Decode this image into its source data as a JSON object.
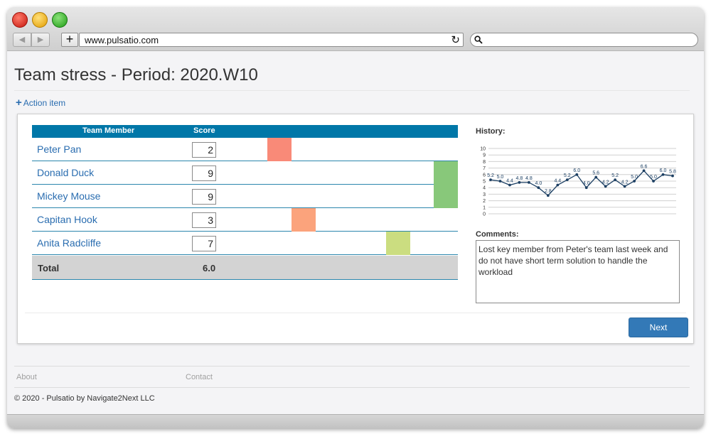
{
  "browser": {
    "url": "www.pulsatio.com",
    "icons": {
      "back": "back-arrow-icon",
      "forward": "forward-arrow-icon",
      "new_tab": "plus-icon",
      "reload": "reload-icon",
      "search": "search-icon"
    }
  },
  "page": {
    "title": "Team stress - Period: 2020.W10",
    "action_item_label": "Action item"
  },
  "table": {
    "headers": {
      "member": "Team Member",
      "score": "Score"
    },
    "rows": [
      {
        "name": "Peter Pan",
        "score": "2",
        "bar_color": "#f98a78"
      },
      {
        "name": "Donald Duck",
        "score": "9",
        "bar_color": "#88c87a"
      },
      {
        "name": "Mickey Mouse",
        "score": "9",
        "bar_color": "#88c87a"
      },
      {
        "name": "Capitan Hook",
        "score": "3",
        "bar_color": "#fba37c"
      },
      {
        "name": "Anita Radcliffe",
        "score": "7",
        "bar_color": "#cbdd80"
      }
    ],
    "score_scale": [
      1,
      10
    ],
    "total_label": "Total",
    "total_value": "6.0"
  },
  "history": {
    "label": "History:",
    "chart_data": {
      "type": "line",
      "title": "",
      "xlabel": "",
      "ylabel": "",
      "ylim": [
        0,
        10
      ],
      "yticks": [
        "0",
        "1",
        "2",
        "3",
        "4",
        "5",
        "6",
        "7",
        "8",
        "9",
        "10"
      ],
      "grid": true,
      "values": [
        5.2,
        5.0,
        4.4,
        4.8,
        4.8,
        4.0,
        2.8,
        4.4,
        5.2,
        6.0,
        4.0,
        5.6,
        4.2,
        5.2,
        4.2,
        5.0,
        6.6,
        5.0,
        6.0,
        5.8
      ],
      "labels": [
        "5.2",
        "5.0",
        "4.4",
        "4.8",
        "4.8",
        "4.0",
        "2.8",
        "4.4",
        "5.2",
        "6.0",
        "4.0",
        "5.6",
        "4.2",
        "5.2",
        "4.2",
        "5.0",
        "6.6",
        "5.0",
        "6.0",
        "5.8"
      ],
      "line_color": "#1c3f63"
    }
  },
  "comments": {
    "label": "Comments:",
    "text": "Lost key member from Peter's team last week and do not have short term solution to handle the workload"
  },
  "actions": {
    "next_label": "Next"
  },
  "footer": {
    "about": "About",
    "contact": "Contact",
    "copyright": "© 2020 - Pulsatio by Navigate2Next LLC"
  }
}
